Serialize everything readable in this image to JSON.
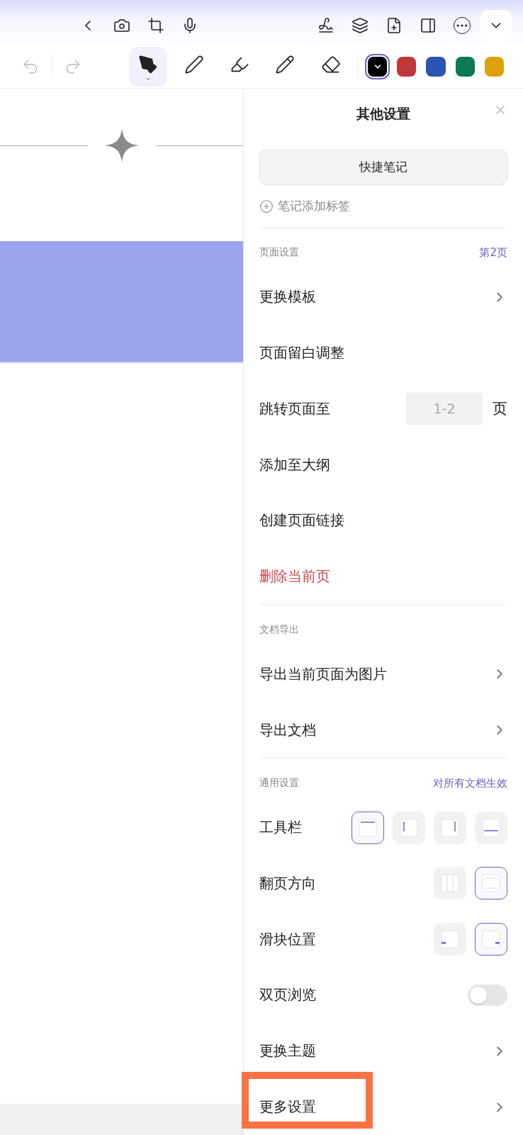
{
  "toolbar": {
    "tools": [
      {
        "kind": "fountain-pen",
        "selected": true
      },
      {
        "kind": "pen",
        "selected": false
      },
      {
        "kind": "highlighter",
        "selected": false
      },
      {
        "kind": "pencil",
        "selected": false
      },
      {
        "kind": "eraser",
        "selected": false
      }
    ],
    "colors": [
      {
        "color": "#000000",
        "selected": true
      },
      {
        "color": "#c0373a",
        "selected": false
      },
      {
        "color": "#2b55b5",
        "selected": false
      },
      {
        "color": "#0c7a52",
        "selected": false
      },
      {
        "color": "#dca20e",
        "selected": false
      }
    ]
  },
  "panel": {
    "title": "其他设置",
    "quick_note_button": "快捷笔记",
    "add_tag": "笔记添加标签",
    "sections": [
      {
        "title": "页面设置",
        "note": "第2页",
        "rows": [
          {
            "kind": "nav",
            "label": "更换模板"
          },
          {
            "kind": "plain",
            "label": "页面留白调整"
          },
          {
            "kind": "page-input",
            "label": "跳转页面至",
            "placeholder": "1-2",
            "unit": "页"
          },
          {
            "kind": "plain",
            "label": "添加至大纲"
          },
          {
            "kind": "plain",
            "label": "创建页面链接"
          },
          {
            "kind": "danger",
            "label": "删除当前页"
          }
        ]
      },
      {
        "title": "文档导出",
        "rows": [
          {
            "kind": "nav",
            "label": "导出当前页面为图片"
          },
          {
            "kind": "nav",
            "label": "导出文档"
          }
        ]
      },
      {
        "title": "通用设置",
        "note": "对所有文档生效",
        "rows": [
          {
            "kind": "options",
            "label": "工具栏",
            "options": [
              {
                "kind": "top",
                "selected": true
              },
              {
                "kind": "left",
                "selected": false
              },
              {
                "kind": "right",
                "selected": false
              },
              {
                "kind": "bottom",
                "selected": false
              }
            ]
          },
          {
            "kind": "options",
            "label": "翻页方向",
            "options": [
              {
                "kind": "horizontal",
                "selected": false
              },
              {
                "kind": "vertical",
                "selected": true
              }
            ]
          },
          {
            "kind": "options",
            "label": "滑块位置",
            "options": [
              {
                "kind": "slider-left",
                "selected": false
              },
              {
                "kind": "slider-right",
                "selected": true
              }
            ]
          },
          {
            "kind": "switch",
            "label": "双页浏览",
            "on": false
          },
          {
            "kind": "nav",
            "label": "更换主题"
          },
          {
            "kind": "nav",
            "label": "更多设置",
            "highlighted": true
          }
        ]
      }
    ]
  }
}
